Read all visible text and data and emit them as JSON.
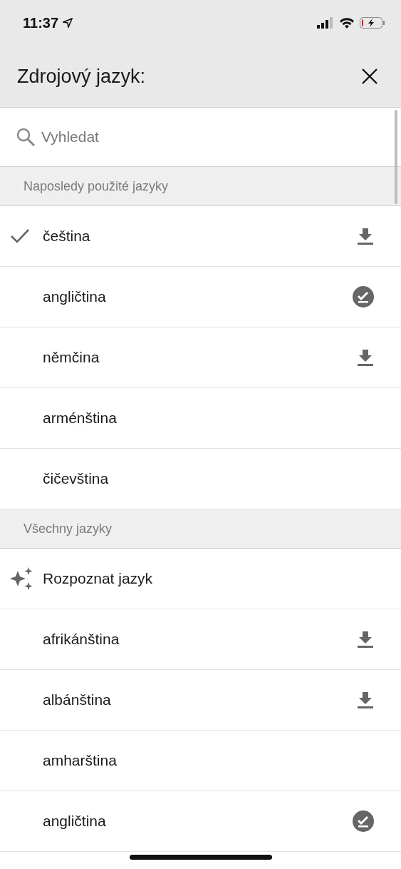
{
  "status_bar": {
    "time": "11:37"
  },
  "header": {
    "title": "Zdrojový jazyk:"
  },
  "search": {
    "placeholder": "Vyhledat"
  },
  "sections": [
    {
      "title": "Naposledy použité jazyky",
      "items": [
        {
          "kind": "language",
          "label": "čeština",
          "selected": true,
          "downloadable": true,
          "downloaded": false
        },
        {
          "kind": "language",
          "label": "angličtina",
          "selected": false,
          "downloadable": false,
          "downloaded": true
        },
        {
          "kind": "language",
          "label": "němčina",
          "selected": false,
          "downloadable": true,
          "downloaded": false
        },
        {
          "kind": "language",
          "label": "arménština",
          "selected": false,
          "downloadable": false,
          "downloaded": false
        },
        {
          "kind": "language",
          "label": "čičevština",
          "selected": false,
          "downloadable": false,
          "downloaded": false
        }
      ]
    },
    {
      "title": "Všechny jazyky",
      "items": [
        {
          "kind": "detect",
          "label": "Rozpoznat jazyk",
          "selected": false,
          "downloadable": false,
          "downloaded": false
        },
        {
          "kind": "language",
          "label": "afrikánština",
          "selected": false,
          "downloadable": true,
          "downloaded": false
        },
        {
          "kind": "language",
          "label": "albánština",
          "selected": false,
          "downloadable": true,
          "downloaded": false
        },
        {
          "kind": "language",
          "label": "amharština",
          "selected": false,
          "downloadable": false,
          "downloaded": false
        },
        {
          "kind": "language",
          "label": "angličtina",
          "selected": false,
          "downloadable": false,
          "downloaded": true
        }
      ]
    }
  ]
}
